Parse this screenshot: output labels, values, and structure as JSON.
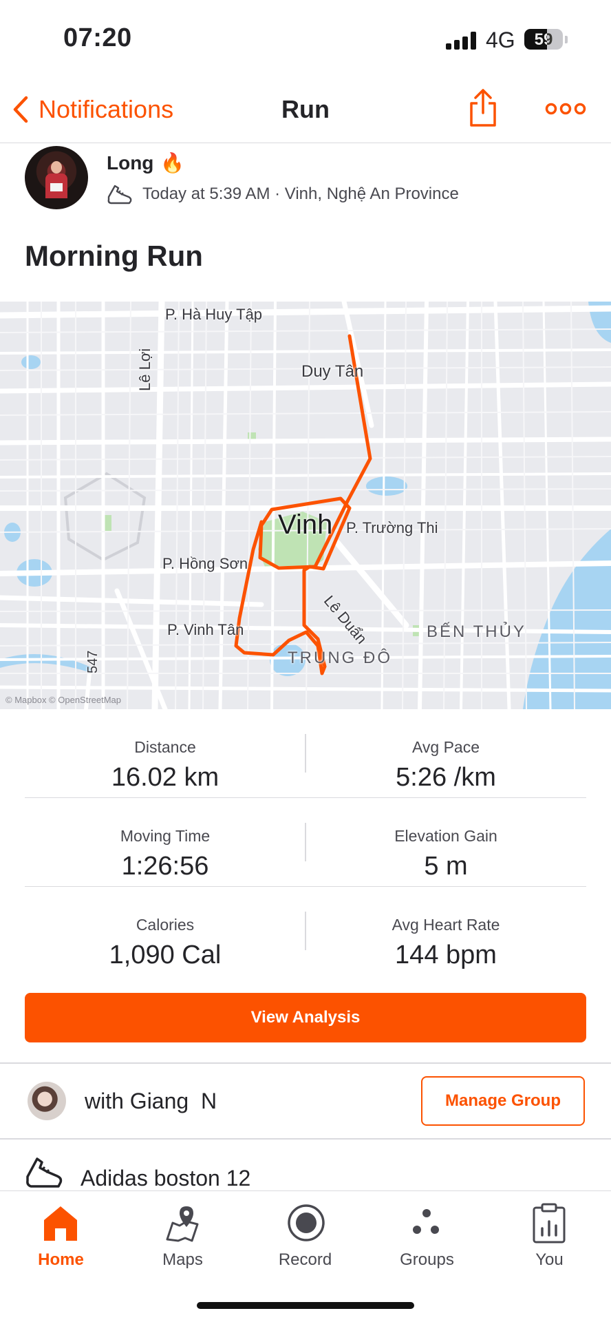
{
  "status_bar": {
    "time": "07:20",
    "network": "4G",
    "battery": "59",
    "battery_level": 0.59
  },
  "nav": {
    "back_label": "Notifications",
    "title": "Run"
  },
  "athlete": {
    "name": "Long",
    "emoji": "🔥",
    "meta": "Today at 5:39 AM · Vinh, Nghệ An Province"
  },
  "activity": {
    "title": "Morning Run"
  },
  "map": {
    "labels": [
      "P. Hà Huy Tập",
      "Duy Tân",
      "Lê Lợi",
      "Vinh",
      "P. Trường Thi",
      "P. Hồng Sơn",
      "Lê Duẩn",
      "P. Vinh Tân",
      "BẾN THỦY",
      "TRUNG ĐÔ",
      "547"
    ],
    "credit": "© Mapbox © OpenStreetMap",
    "route_color": "#fc5200"
  },
  "stats": [
    {
      "left": {
        "label": "Distance",
        "value": "16.02 km"
      },
      "right": {
        "label": "Avg Pace",
        "value": "5:26 /km"
      }
    },
    {
      "left": {
        "label": "Moving Time",
        "value": "1:26:56"
      },
      "right": {
        "label": "Elevation Gain",
        "value": "5 m"
      }
    },
    {
      "left": {
        "label": "Calories",
        "value": "1,090 Cal"
      },
      "right": {
        "label": "Avg Heart Rate",
        "value": "144 bpm"
      }
    }
  ],
  "view_analysis_label": "View Analysis",
  "group": {
    "text": "with Giang  N",
    "manage_label": "Manage Group"
  },
  "gear": {
    "text": "Adidas boston 12"
  },
  "tabs": [
    {
      "label": "Home",
      "icon": "home-icon",
      "active": true
    },
    {
      "label": "Maps",
      "icon": "map-icon",
      "active": false
    },
    {
      "label": "Record",
      "icon": "record-icon",
      "active": false
    },
    {
      "label": "Groups",
      "icon": "groups-icon",
      "active": false
    },
    {
      "label": "You",
      "icon": "profile-icon",
      "active": false
    }
  ],
  "colors": {
    "accent": "#fc5200",
    "text": "#242428",
    "secondary_text": "#494950",
    "divider": "#dadade"
  }
}
